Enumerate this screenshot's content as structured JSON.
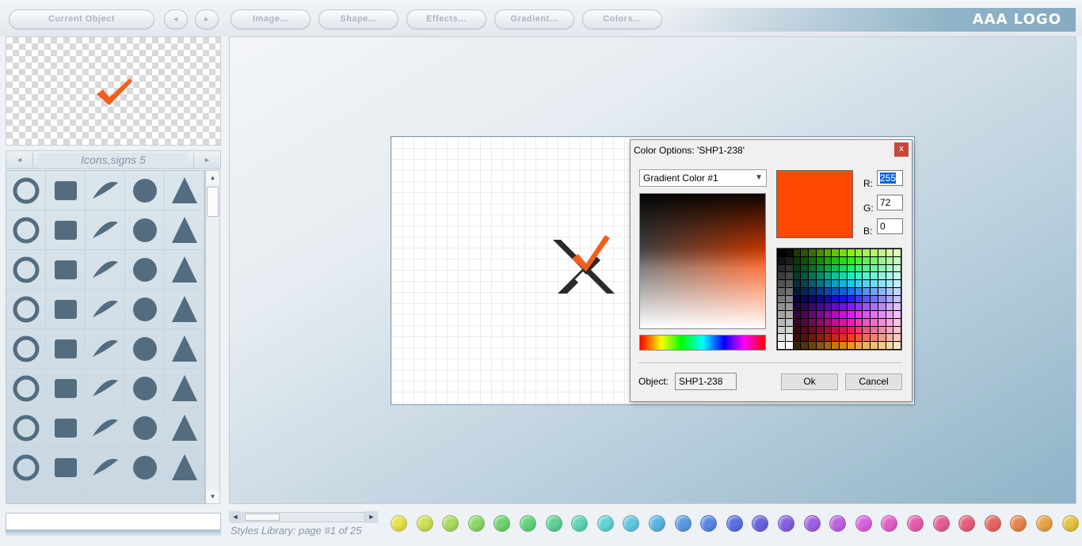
{
  "toolbar": {
    "current_object": "Current Object",
    "prev_arrow": "◄",
    "next_arrow": "►",
    "image": "Image...",
    "shape": "Shape...",
    "effects": "Effects...",
    "gradient": "Gradient...",
    "colors": "Colors...",
    "logo": "AAA LOGO"
  },
  "library": {
    "title": "Icons,signs 5",
    "prev_arrow": "◄",
    "next_arrow": "►",
    "icons": [
      "people-waves-icon",
      "swirl-ring-icon",
      "swoosh-icon",
      "wave-line-icon",
      "telephone-icon",
      "coffee-cup-icon",
      "s-curve-icon",
      "bowl-icon",
      "gears-icon",
      "fan-icon",
      "spiral-wave-icon",
      "no-smoking-icon",
      "moon-circle-icon",
      "globe-icon",
      "hand-print-icon",
      "turtle-icon",
      "family-icon",
      "clover-icon",
      "lion-head-icon",
      "brick-wall-icon",
      "calculator-icon",
      "spiral-icon",
      "spiral-circle-icon",
      "tree-outline-icon",
      "tree-icon",
      "fire-warning-icon",
      "handshake-icon",
      "fire-circle-icon",
      "flame-icon",
      "church-icon",
      "sun-house-icon",
      "house-icon",
      "wings-emblem-icon",
      "wing-line-icon",
      "palm-tree-icon",
      "face-icon",
      "bomb-icon",
      "paint-brush-icon",
      "hand-brush-icon",
      "bus-icon"
    ]
  },
  "dialog": {
    "title": "Color Options: 'SHP1-238'",
    "close": "x",
    "select_value": "Gradient Color #1",
    "caret": "▼",
    "swatch_color": "#ff4800",
    "r_label": "R:",
    "g_label": "G:",
    "b_label": "B:",
    "r_value": "255",
    "g_value": "72",
    "b_value": "0",
    "object_label": "Object:",
    "object_value": "SHP1-238",
    "ok": "Ok",
    "cancel": "Cancel"
  },
  "bottom": {
    "scroll_left": "◄",
    "scroll_right": "►",
    "page_label": "Styles Library: page #1 of 25",
    "style_colors": [
      "#e6e24a",
      "#cde055",
      "#a9dc60",
      "#8cd867",
      "#6fd46f",
      "#62d37c",
      "#5dd294",
      "#5fd3b5",
      "#63d5d3",
      "#62c9e0",
      "#5cb4e2",
      "#5a9de4",
      "#5787e4",
      "#5b70e2",
      "#6a63e0",
      "#8461e0",
      "#9f61e0",
      "#bd62df",
      "#d963dc",
      "#e45fc8",
      "#e65eae",
      "#e65e95",
      "#e6607a",
      "#e66562",
      "#e6864d",
      "#e7a546",
      "#e6c441"
    ]
  }
}
